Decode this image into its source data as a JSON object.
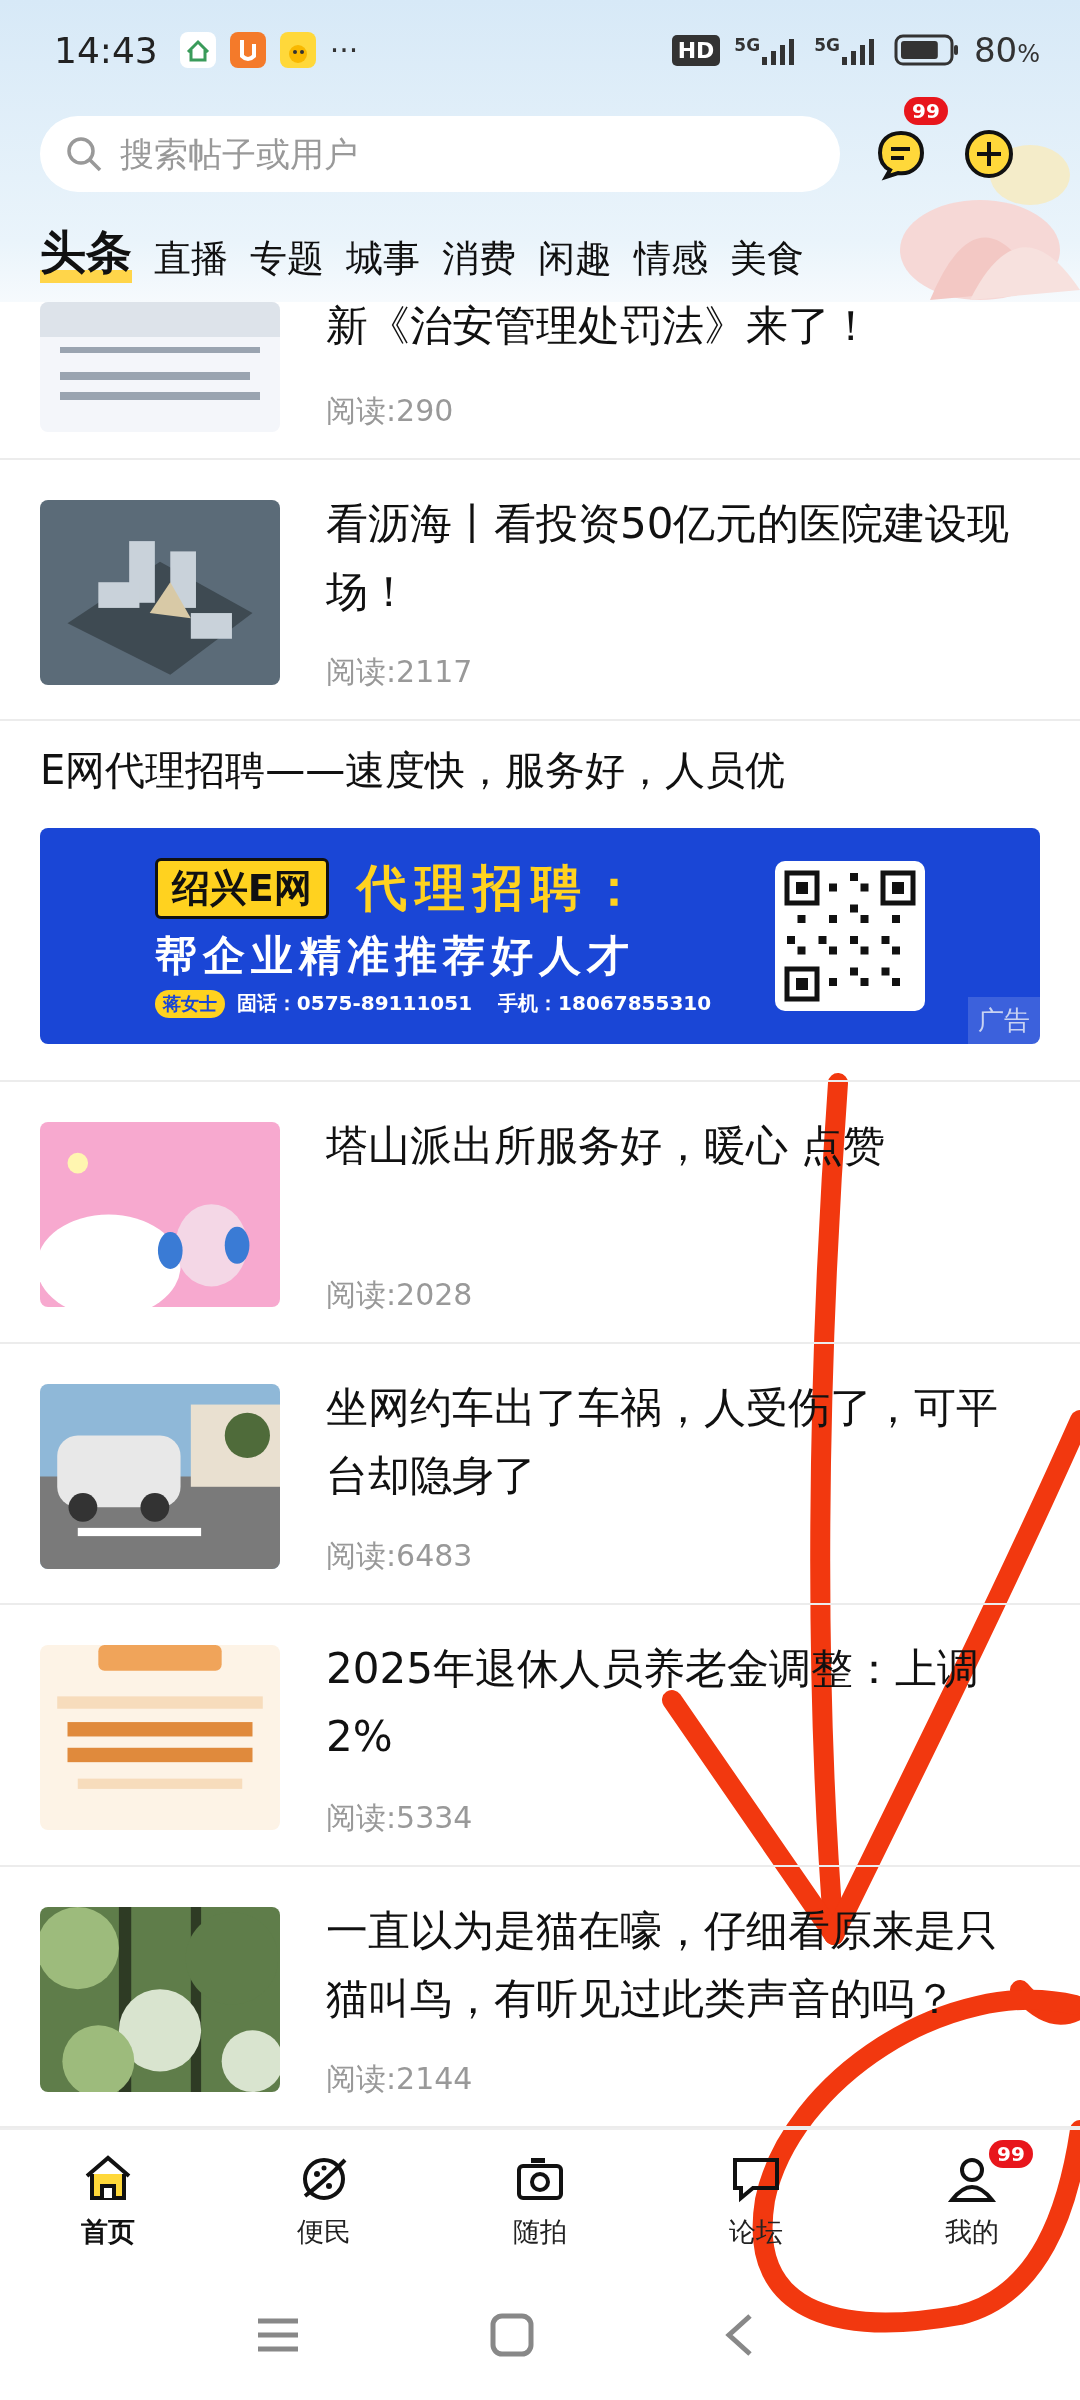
{
  "status_bar": {
    "time": "14:43",
    "more": "···",
    "hd": "HD",
    "networks": [
      "5G",
      "5G"
    ],
    "battery": "80",
    "battery_unit": "%"
  },
  "search": {
    "placeholder": "搜索帖子或用户"
  },
  "messages_badge": "99",
  "tabs": [
    {
      "label": "头条",
      "selected": true
    },
    {
      "label": "直播",
      "selected": false
    },
    {
      "label": "专题",
      "selected": false
    },
    {
      "label": "城事",
      "selected": false
    },
    {
      "label": "消费",
      "selected": false
    },
    {
      "label": "闲趣",
      "selected": false
    },
    {
      "label": "情感",
      "selected": false
    },
    {
      "label": "美食",
      "selected": false
    }
  ],
  "feed": [
    {
      "kind": "article",
      "title": "新《治安管理处罚法》来了！",
      "reads": "阅读:290"
    },
    {
      "kind": "article",
      "title": "看沥海丨看投资50亿元的医院建设现场！",
      "reads": "阅读:2117"
    },
    {
      "kind": "ad",
      "title": "E网代理招聘——速度快，服务好，人员优",
      "brand": "绍兴E网",
      "headline": "代理招聘：",
      "slogan": "帮企业精准推荐好人才",
      "contact": "蒋女士",
      "phone": "固话：0575-89111051",
      "mobile": "手机：18067855310",
      "ad_label": "广告"
    },
    {
      "kind": "article",
      "title": "塔山派出所服务好，暖心 点赞",
      "reads": "阅读:2028"
    },
    {
      "kind": "article",
      "title": "坐网约车出了车祸，人受伤了，可平台却隐身了",
      "reads": "阅读:6483"
    },
    {
      "kind": "article",
      "title": "2025年退休人员养老金调整：上调2%",
      "reads": "阅读:5334"
    },
    {
      "kind": "article",
      "title": "一直以为是猫在嚎，仔细看原来是只猫叫鸟，有听见过此类声音的吗？",
      "reads": "阅读:2144"
    }
  ],
  "nav": [
    {
      "label": "首页",
      "selected": true
    },
    {
      "label": "便民",
      "selected": false
    },
    {
      "label": "随拍",
      "selected": false
    },
    {
      "label": "论坛",
      "selected": false
    },
    {
      "label": "我的",
      "selected": false,
      "badge": "99"
    }
  ]
}
